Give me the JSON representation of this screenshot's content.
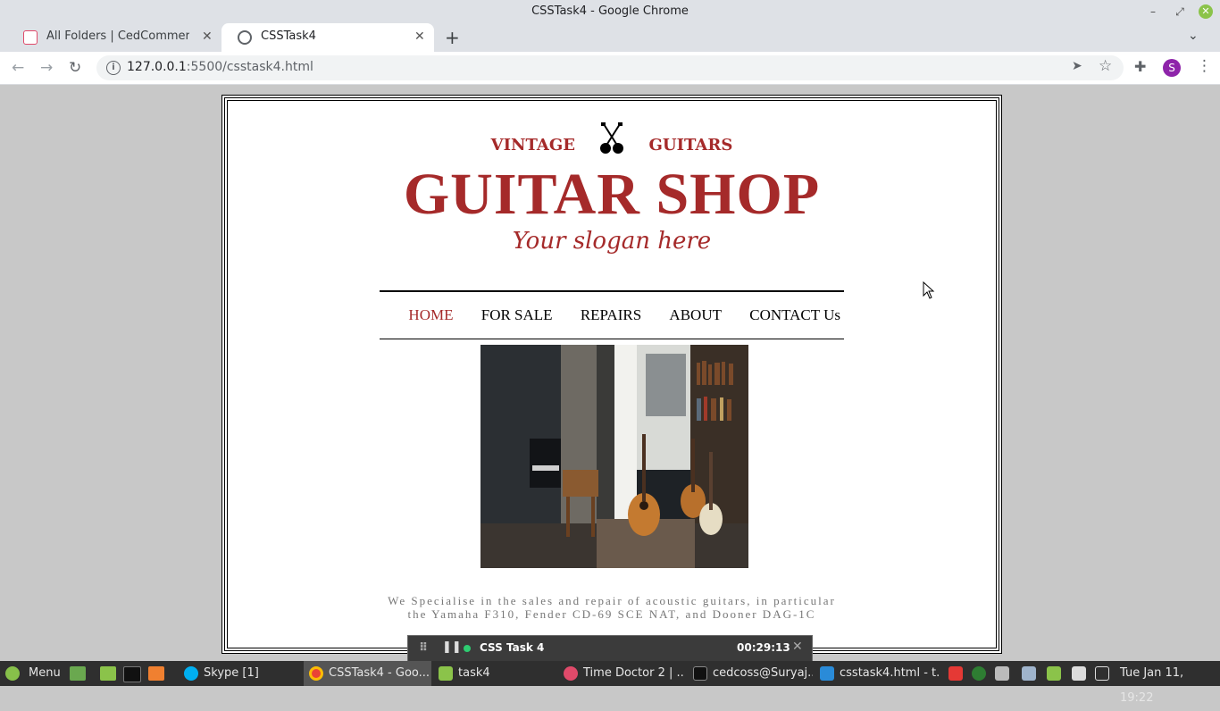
{
  "window": {
    "title": "CSSTask4 - Google Chrome",
    "controls": {
      "minimize": "–",
      "maximize": "⤢",
      "close": "✕"
    }
  },
  "tabs": [
    {
      "label": "All Folders | CedCommerce (L",
      "close": "✕",
      "active": false
    },
    {
      "label": "CSSTask4",
      "close": "✕",
      "active": true
    }
  ],
  "tabstrip": {
    "new_tab": "+",
    "menu": "⌄"
  },
  "toolbar": {
    "back": "←",
    "forward": "→",
    "reload": "↻",
    "url_host": "127.0.0.1",
    "url_rest": ":5500/csstask4.html",
    "info": "i",
    "send": "➤",
    "star": "☆",
    "puzzle": "✚",
    "avatar_letter": "S",
    "menu": "⋮"
  },
  "page": {
    "brand_left": "VINTAGE",
    "brand_right": "GUITARS",
    "title": "GUITAR SHOP",
    "slogan": "Your slogan here",
    "nav": [
      "HOME",
      "FOR SALE",
      "REPAIRS",
      "ABOUT",
      "CONTACT Us"
    ],
    "nav_active": "HOME",
    "description": "We Specialise in the sales and repair of acoustic guitars, in particular the Yamaha F310, Fender CD-69 SCE NAT, and Dooner DAG-1C",
    "accent_color": "#a52a2a"
  },
  "recorder": {
    "title": "CSS Task 4",
    "time": "00:29:13",
    "close": "✕",
    "status_color": "#2ecc71"
  },
  "taskbar": {
    "menu_label": "Menu",
    "items": [
      {
        "label": "Skype [1]",
        "icon": "skype-icon"
      },
      {
        "label": "CSSTask4 - Goo...",
        "icon": "chrome-icon"
      },
      {
        "label": "task4",
        "icon": "folder-icon"
      },
      {
        "label": "Time Doctor 2 | ...",
        "icon": "timedoctor-icon"
      },
      {
        "label": "cedcoss@Suryaj...",
        "icon": "terminal-icon"
      },
      {
        "label": "csstask4.html - t...",
        "icon": "vscode-icon"
      }
    ],
    "clock": "Tue Jan 11, 19:22"
  }
}
